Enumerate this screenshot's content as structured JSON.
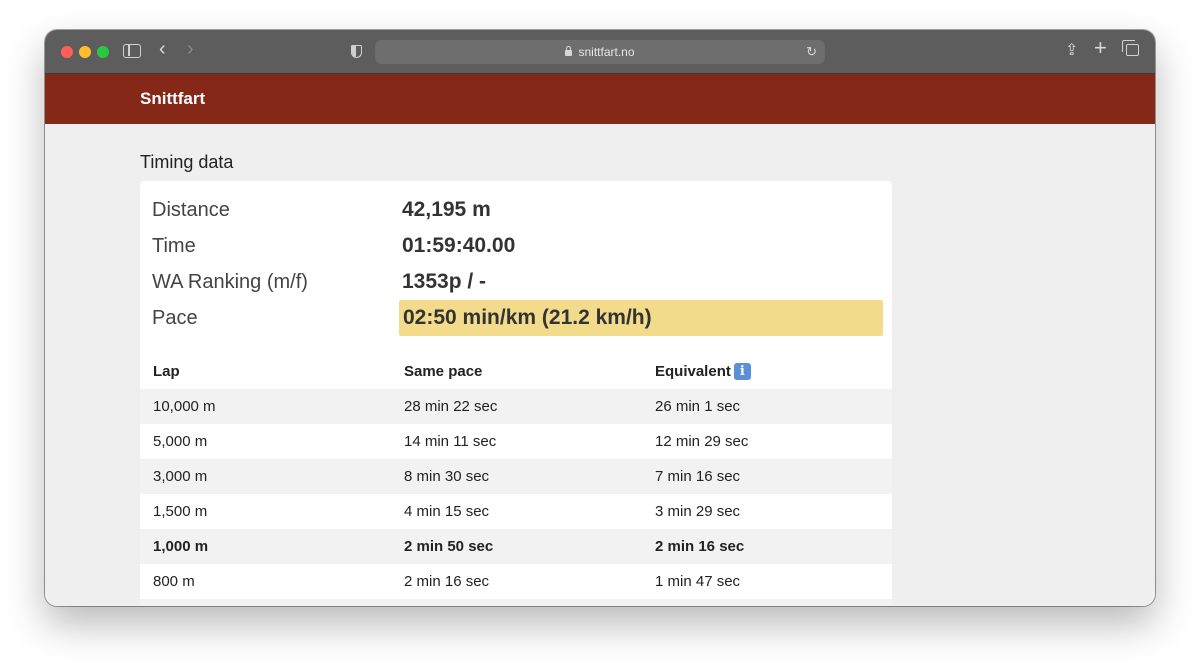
{
  "browser": {
    "url": "snittfart.no"
  },
  "site": {
    "brand": "Snittfart"
  },
  "section_title": "Timing data",
  "summary": [
    {
      "label": "Distance",
      "value": "42,195 m"
    },
    {
      "label": "Time",
      "value": "01:59:40.00"
    },
    {
      "label": "WA Ranking (m/f)",
      "value": "1353p / -"
    },
    {
      "label": "Pace",
      "value": "02:50 min/km (21.2 km/h)"
    }
  ],
  "table": {
    "headers": [
      "Lap",
      "Same pace",
      "Equivalent"
    ],
    "rows": [
      [
        "10,000 m",
        "28 min 22 sec",
        "26 min 1 sec"
      ],
      [
        "5,000 m",
        "14 min 11 sec",
        "12 min 29 sec"
      ],
      [
        "3,000 m",
        "8 min 30 sec",
        "7 min 16 sec"
      ],
      [
        "1,500 m",
        "4 min 15 sec",
        "3 min 29 sec"
      ],
      [
        "1,000 m",
        "2 min 50 sec",
        "2 min 16 sec"
      ],
      [
        "800 m",
        "2 min 16 sec",
        "1 min 47 sec"
      ]
    ]
  },
  "icons": {
    "info": "information-icon"
  },
  "colors": {
    "navbar": "#852818",
    "pace_highlight": "#f2db8a",
    "info_icon": "#5b8fd6"
  }
}
